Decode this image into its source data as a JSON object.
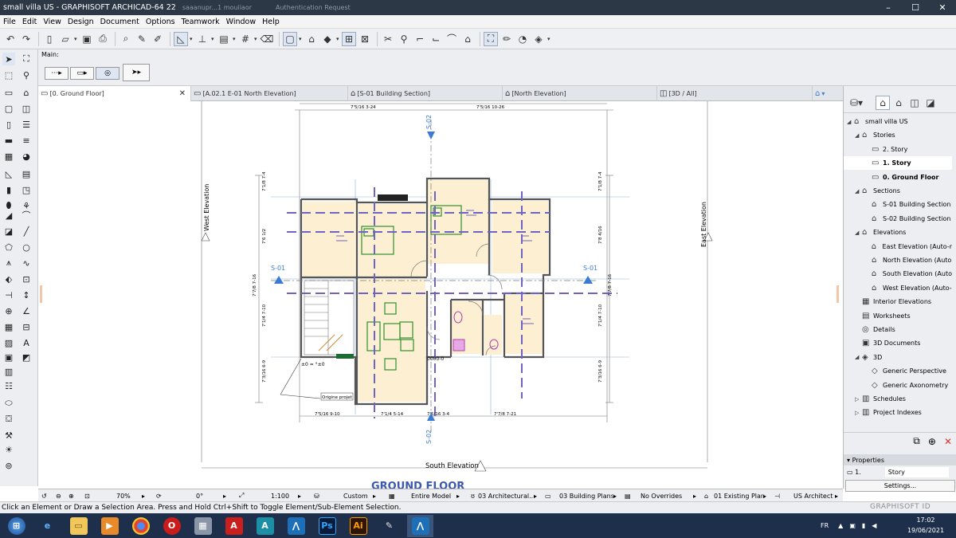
{
  "window": {
    "title": "small villa US - GRAPHISOFT ARCHICAD-64 22",
    "bg_tabs": [
      "saaanupr...1 mouiiaor",
      "Authentication Request"
    ]
  },
  "menu": [
    "File",
    "Edit",
    "View",
    "Design",
    "Document",
    "Options",
    "Teamwork",
    "Window",
    "Help"
  ],
  "infobox": {
    "label": "Main:"
  },
  "tabs": [
    {
      "label": "[0. Ground Floor]",
      "active": true
    },
    {
      "label": "[A.02.1 E-01 North Elevation]",
      "active": false
    },
    {
      "label": "[S-01 Building Section]",
      "active": false
    },
    {
      "label": "[North Elevation]",
      "active": false
    },
    {
      "label": "[3D / All]",
      "active": false
    }
  ],
  "drawing": {
    "title": "GROUND FLOOR",
    "markers": {
      "west": "West Elevation",
      "east": "East Elevation",
      "south": "South Elevation",
      "s01": "S-01",
      "s02": "S-02"
    },
    "dims_top": [
      "7'5/16 3-24",
      "7'5/16 10-26"
    ],
    "dims_bottom": [
      "7'5/16 9-10",
      "7'1/4 5-14",
      "7'5/16 3-4",
      "7'7/8 7-21"
    ],
    "dims_left": [
      "7'1/8 7-4",
      "7'6 1/2",
      "7'7/8 7-16",
      "7'1/4 7-10",
      "7'3/16 6-9"
    ],
    "dims_right": [
      "7'1/8 7-4",
      "7'8 4/16",
      "7'7/8 7-16",
      "7'1/4 7-10",
      "7'3/16 6-9"
    ],
    "origin_label": "Origine projet",
    "origin_coords": "±0 = °±0",
    "level_tag": "0000-0"
  },
  "navigator": {
    "items": [
      {
        "label": "small villa US",
        "level": 0,
        "arrow": "◢",
        "icon": "⌂"
      },
      {
        "label": "Stories",
        "level": 1,
        "arrow": "◢",
        "icon": "⌂"
      },
      {
        "label": "2. Story",
        "level": 2,
        "arrow": "",
        "icon": "▭"
      },
      {
        "label": "1. Story",
        "level": 2,
        "arrow": "",
        "icon": "▭",
        "sel": true
      },
      {
        "label": "0. Ground Floor",
        "level": 2,
        "arrow": "",
        "icon": "▭",
        "bold": true
      },
      {
        "label": "Sections",
        "level": 1,
        "arrow": "◢",
        "icon": "⌂"
      },
      {
        "label": "S-01 Building Section",
        "level": 2,
        "arrow": "",
        "icon": "⌂"
      },
      {
        "label": "S-02 Building Section",
        "level": 2,
        "arrow": "",
        "icon": "⌂"
      },
      {
        "label": "Elevations",
        "level": 1,
        "arrow": "◢",
        "icon": "⌂"
      },
      {
        "label": "East Elevation (Auto-r",
        "level": 2,
        "arrow": "",
        "icon": "⌂"
      },
      {
        "label": "North Elevation (Auto",
        "level": 2,
        "arrow": "",
        "icon": "⌂"
      },
      {
        "label": "South Elevation (Auto",
        "level": 2,
        "arrow": "",
        "icon": "⌂"
      },
      {
        "label": "West Elevation (Auto-",
        "level": 2,
        "arrow": "",
        "icon": "⌂"
      },
      {
        "label": "Interior Elevations",
        "level": 1,
        "arrow": "",
        "icon": "▦"
      },
      {
        "label": "Worksheets",
        "level": 1,
        "arrow": "",
        "icon": "▤"
      },
      {
        "label": "Details",
        "level": 1,
        "arrow": "",
        "icon": "◎"
      },
      {
        "label": "3D Documents",
        "level": 1,
        "arrow": "",
        "icon": "▣"
      },
      {
        "label": "3D",
        "level": 1,
        "arrow": "◢",
        "icon": "◈"
      },
      {
        "label": "Generic Perspective",
        "level": 2,
        "arrow": "",
        "icon": "◇"
      },
      {
        "label": "Generic Axonometry",
        "level": 2,
        "arrow": "",
        "icon": "◇"
      },
      {
        "label": "Schedules",
        "level": 1,
        "arrow": "▷",
        "icon": "▥"
      },
      {
        "label": "Project Indexes",
        "level": 1,
        "arrow": "▷",
        "icon": "▥"
      }
    ]
  },
  "properties": {
    "header": "Properties",
    "story_num": "1.",
    "story_name": "Story",
    "settings": "Settings..."
  },
  "status": {
    "zoom": "70%",
    "angle": "0°",
    "scale": "1:100",
    "custom": "Custom",
    "model": "Entire Model",
    "layer": "03 Architectural...",
    "pen": "03 Building Plans",
    "override": "No Overrides",
    "renov": "01 Existing Plan",
    "std": "US Architect"
  },
  "hint": "Click an Element or Draw a Selection Area. Press and Hold Ctrl+Shift to Toggle Element/Sub-Element Selection.",
  "brand": "GRAPHISOFT ID",
  "taskbar": {
    "lang": "FR",
    "time": "17:02",
    "date": "19/06/2021"
  },
  "colors": {
    "accent": "#3a7bd5",
    "wall": "#5a5a5a",
    "fill": "#fdf0d2",
    "dashed": "#6f64c2"
  }
}
